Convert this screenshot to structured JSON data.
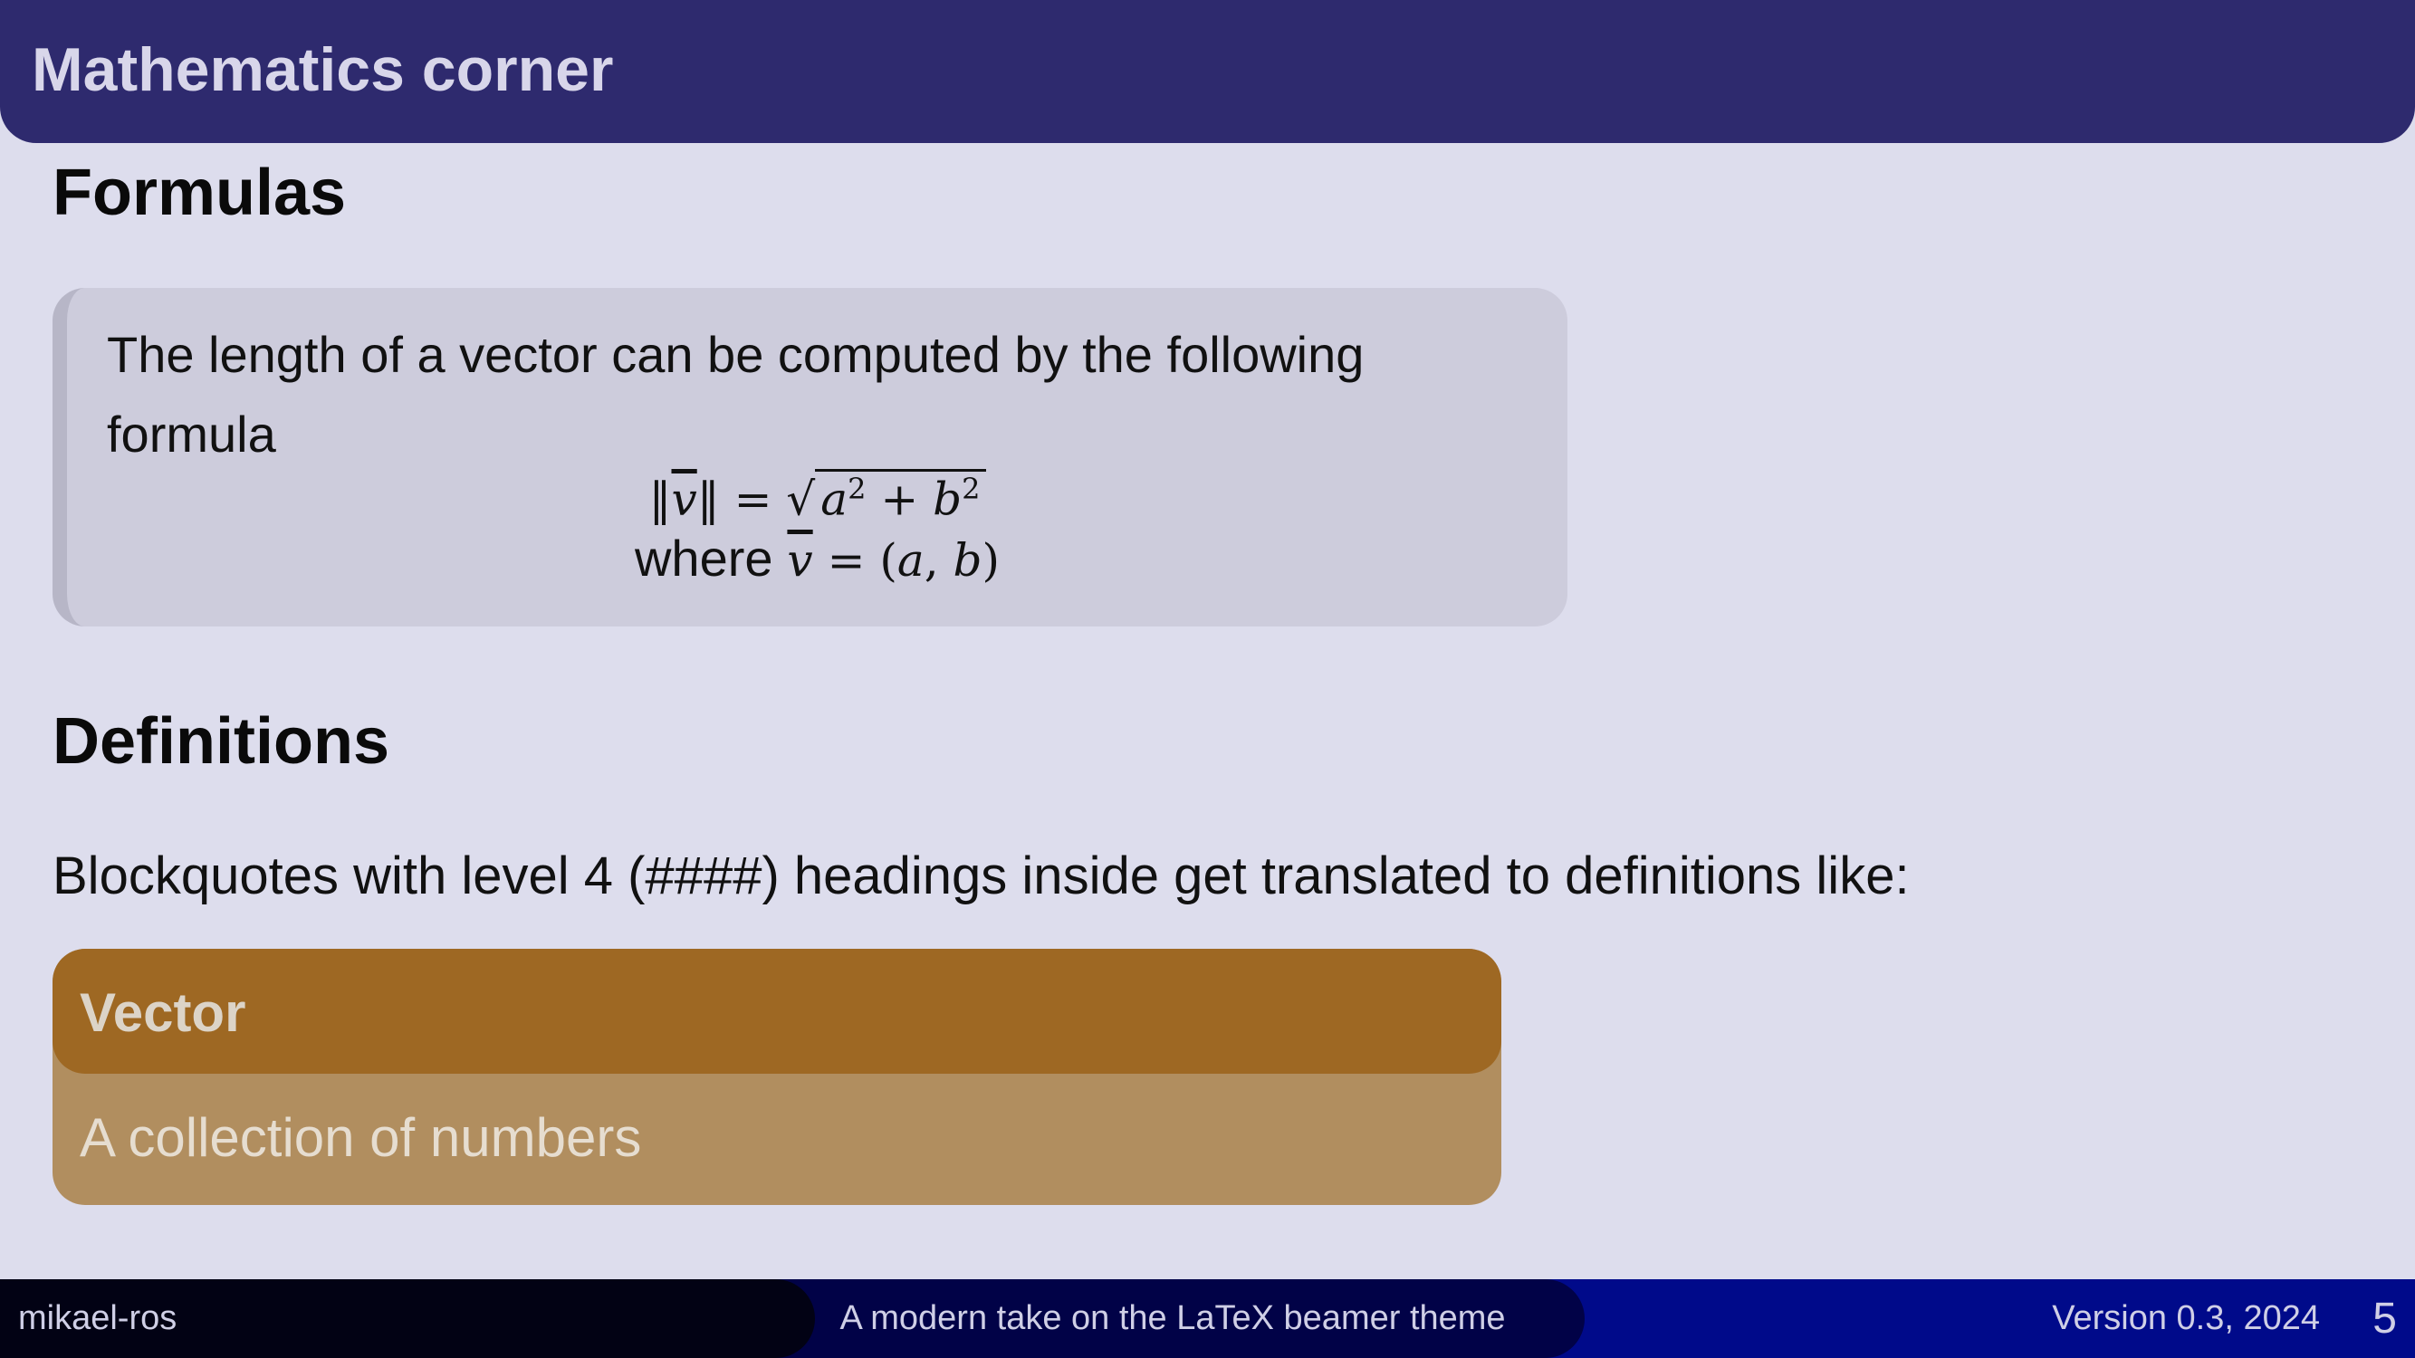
{
  "slide": {
    "frame_title": "Mathematics corner",
    "section_formulas": "Formulas",
    "formula_text": "The length of a vector can be computed by the following formula",
    "math_line1": "‖v‾‖ = √(a² + b²)",
    "math_line2_where": "where",
    "math_line2_rest": "v‾ = (a, b)",
    "section_definitions": "Definitions",
    "definitions_intro": "Blockquotes with level 4 (####) headings inside get translated to definitions like:",
    "definition": {
      "term": "Vector",
      "body": "A collection of numbers"
    }
  },
  "footer": {
    "author": "mikael-ros",
    "subtitle": "A modern take on the LaTeX beamer theme",
    "version": "Version 0.3, 2024",
    "page_number": "5"
  },
  "colors": {
    "title_bar": "#2e2a6e",
    "background": "#dddded",
    "formula_box": "#cdccdc",
    "definition_header": "#9e6823",
    "definition_body": "#b18e5f",
    "footer_right": "#000a8a"
  }
}
